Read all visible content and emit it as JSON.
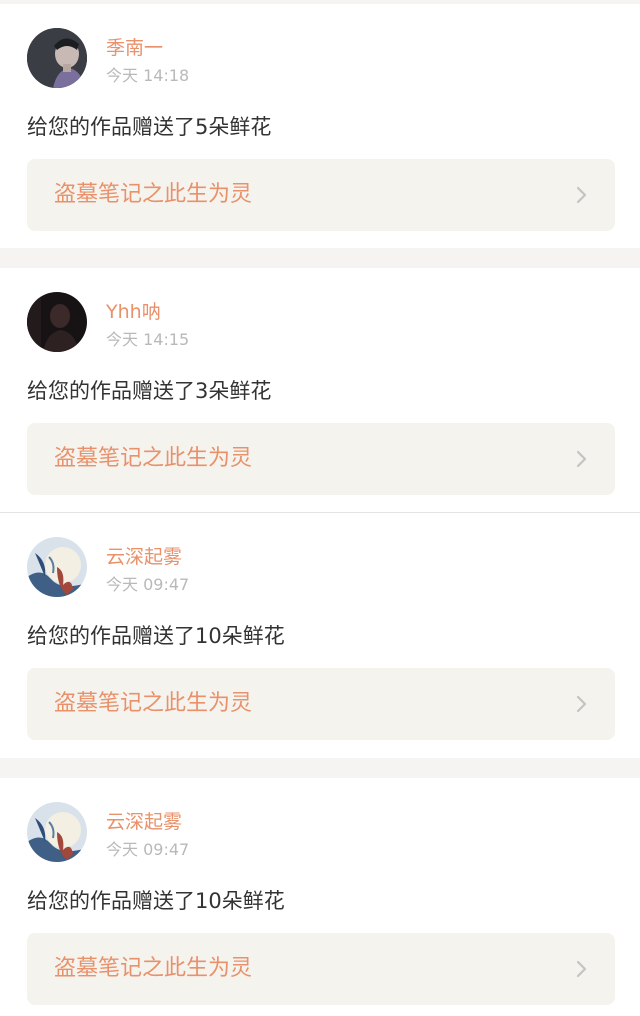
{
  "colors": {
    "page_background": "#f5f4f2",
    "card_background": "#ffffff",
    "accent_orange": "#e8916b",
    "timestamp_gray": "#b9b9b9",
    "message_text": "#333333",
    "link_background": "#f5f3ee",
    "chevron_gray": "#c4c4c4"
  },
  "notifications": [
    {
      "username": "季南一",
      "timestamp": "今天 14:18",
      "message": "给您的作品赠送了5朵鲜花",
      "work_title": "盗墓笔记之此生为灵",
      "avatar_icon": "dark-portrait-avatar",
      "link_icon": "chevron-right-icon"
    },
    {
      "username": "Yhh呐",
      "timestamp": "今天 14:15",
      "message": "给您的作品赠送了3朵鲜花",
      "work_title": "盗墓笔记之此生为灵",
      "avatar_icon": "silhouette-avatar",
      "link_icon": "chevron-right-icon"
    },
    {
      "username": "云深起雾",
      "timestamp": "今天 09:47",
      "message": "给您的作品赠送了10朵鲜花",
      "work_title": "盗墓笔记之此生为灵",
      "avatar_icon": "moon-illustration-avatar",
      "link_icon": "chevron-right-icon"
    },
    {
      "username": "云深起雾",
      "timestamp": "今天 09:47",
      "message": "给您的作品赠送了10朵鲜花",
      "work_title": "盗墓笔记之此生为灵",
      "avatar_icon": "moon-illustration-avatar",
      "link_icon": "chevron-right-icon"
    }
  ]
}
